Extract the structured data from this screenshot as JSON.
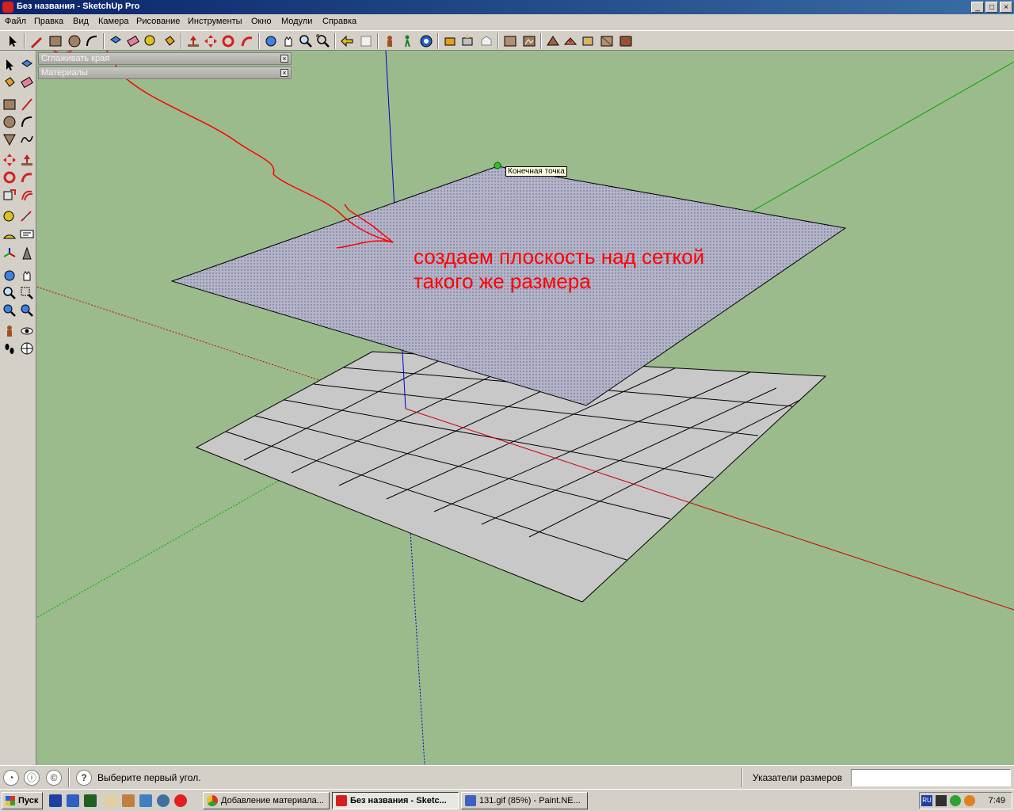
{
  "window": {
    "title": "Без названия - SketchUp Pro",
    "minimize": "_",
    "maximize": "□",
    "close": "×"
  },
  "menubar": [
    "Файл",
    "Правка",
    "Вид",
    "Камера",
    "Рисование",
    "Инструменты",
    "Окно",
    "Модули",
    "Справка"
  ],
  "trays": [
    {
      "label": "Сглаживать края",
      "close": "×"
    },
    {
      "label": "Материалы",
      "close": "×"
    }
  ],
  "viewport": {
    "tooltip": "Конечная точка",
    "annotation": [
      "создаем плоскость над сеткой",
      "такого же размера"
    ],
    "colors": {
      "background": "#9bbb8c",
      "red_axis": "#cc0000",
      "green_axis": "#00aa00",
      "blue_axis": "#0000cc",
      "face": "#b4b4c8",
      "grid_face": "#c8c8c8",
      "annotation": "#ff0000"
    }
  },
  "statusbar": {
    "icons": [
      "geo-location-icon",
      "credits-icon",
      "account-icon"
    ],
    "help_icon": "?",
    "message": "Выберите первый угол.",
    "measurements_label": "Указатели размеров",
    "measurements_value": ""
  },
  "taskbar": {
    "start": "Пуск",
    "tasks": [
      {
        "label": "Добавление материала...",
        "icon": "chrome-icon",
        "active": false
      },
      {
        "label": "Без названия - Sketc...",
        "icon": "sketchup-icon",
        "active": true
      },
      {
        "label": "131.gif (85%) - Paint.NE...",
        "icon": "paintnet-icon",
        "active": false
      }
    ],
    "language": "RU",
    "clock": "7:49"
  }
}
